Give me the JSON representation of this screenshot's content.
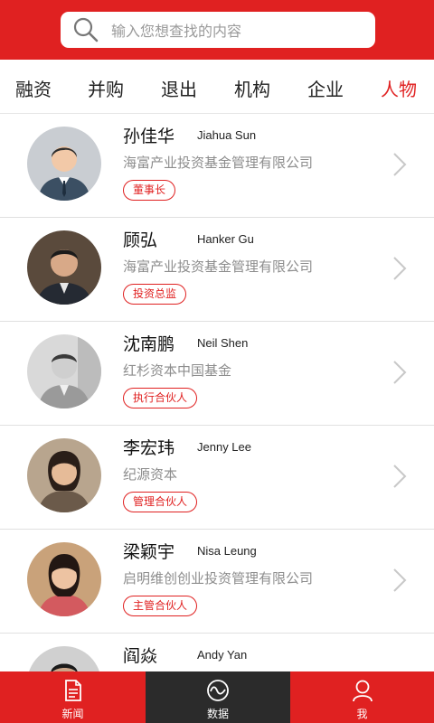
{
  "search": {
    "placeholder": "输入您想查找的内容"
  },
  "tabs": [
    {
      "label": "融资",
      "active": false
    },
    {
      "label": "并购",
      "active": false
    },
    {
      "label": "退出",
      "active": false
    },
    {
      "label": "机构",
      "active": false
    },
    {
      "label": "企业",
      "active": false
    },
    {
      "label": "人物",
      "active": true
    }
  ],
  "people": [
    {
      "name_cn": "孙佳华",
      "name_en": "Jiahua Sun",
      "company": "海富产业投资基金管理有限公司",
      "title": "董事长",
      "avatar": "placeholder-avatar"
    },
    {
      "name_cn": "顾弘",
      "name_en": "Hanker Gu",
      "company": "海富产业投资基金管理有限公司",
      "title": "投资总监",
      "avatar": "photo-avatar"
    },
    {
      "name_cn": "沈南鹏",
      "name_en": "Neil Shen",
      "company": "红杉资本中国基金",
      "title": "执行合伙人",
      "avatar": "photo-avatar"
    },
    {
      "name_cn": "李宏玮",
      "name_en": "Jenny Lee",
      "company": "纪源资本",
      "title": "管理合伙人",
      "avatar": "photo-avatar"
    },
    {
      "name_cn": "梁颖宇",
      "name_en": "Nisa Leung",
      "company": "启明维创创业投资管理有限公司",
      "title": "主管合伙人",
      "avatar": "photo-avatar"
    },
    {
      "name_cn": "阎焱",
      "name_en": "Andy Yan",
      "company": "",
      "title": "",
      "avatar": "photo-avatar"
    }
  ],
  "bottom_nav": [
    {
      "label": "新闻",
      "icon": "news-icon",
      "active": false
    },
    {
      "label": "数据",
      "icon": "data-icon",
      "active": true
    },
    {
      "label": "我",
      "icon": "person-icon",
      "active": false
    }
  ],
  "colors": {
    "accent": "#e02121",
    "nav_active_bg": "#2b2b2b",
    "muted_text": "#8d8d8d"
  }
}
